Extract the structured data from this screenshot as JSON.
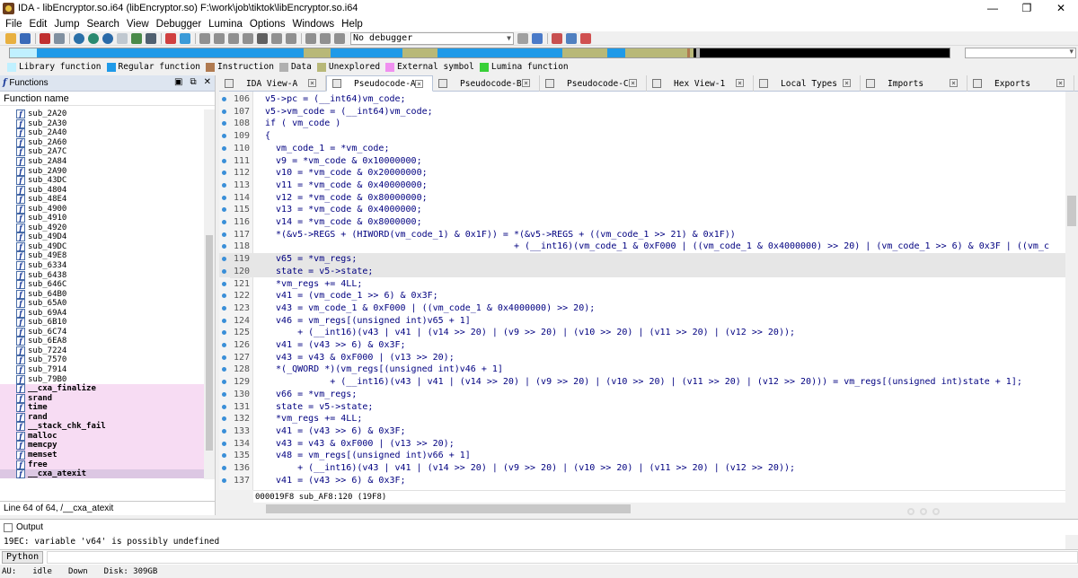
{
  "window": {
    "title": "IDA - libEncryptor.so.i64 (libEncryptor.so) F:\\work\\job\\tiktok\\libEncryptor.so.i64",
    "controls": [
      "—",
      "❐",
      "✕"
    ]
  },
  "menu": [
    "File",
    "Edit",
    "Jump",
    "Search",
    "View",
    "Debugger",
    "Lumina",
    "Options",
    "Windows",
    "Help"
  ],
  "toolbar": {
    "debugger_select": "No debugger"
  },
  "colors": {
    "library_function": "#c0f0ff",
    "regular_function": "#1f9ae8",
    "instruction": "#b07a50",
    "data": "#b0b0b0",
    "unexplored": "#b8b878",
    "external_symbol": "#f090f0",
    "lumina_function": "#38d038",
    "pane_header": "#dde5f0",
    "library_row": "#f7dcf3",
    "selected_row": "#dcc7e3"
  },
  "legend": [
    {
      "label": "Library function",
      "color": "#c0f0ff"
    },
    {
      "label": "Regular function",
      "color": "#1f9ae8"
    },
    {
      "label": "Instruction",
      "color": "#b07a50"
    },
    {
      "label": "Data",
      "color": "#b0b0b0"
    },
    {
      "label": "Unexplored",
      "color": "#b8b878"
    },
    {
      "label": "External symbol",
      "color": "#f090f0"
    },
    {
      "label": "Lumina function",
      "color": "#38d038"
    }
  ],
  "functions_pane": {
    "title": "Functions",
    "column": "Function name",
    "items": [
      {
        "name": "sub_2A20",
        "kind": "regular"
      },
      {
        "name": "sub_2A30",
        "kind": "regular"
      },
      {
        "name": "sub_2A40",
        "kind": "regular"
      },
      {
        "name": "sub_2A60",
        "kind": "regular"
      },
      {
        "name": "sub_2A7C",
        "kind": "regular"
      },
      {
        "name": "sub_2A84",
        "kind": "regular"
      },
      {
        "name": "sub_2A90",
        "kind": "regular"
      },
      {
        "name": "sub_43DC",
        "kind": "regular"
      },
      {
        "name": "sub_4804",
        "kind": "regular"
      },
      {
        "name": "sub_48E4",
        "kind": "regular"
      },
      {
        "name": "sub_4900",
        "kind": "regular"
      },
      {
        "name": "sub_4910",
        "kind": "regular"
      },
      {
        "name": "sub_4920",
        "kind": "regular"
      },
      {
        "name": "sub_49D4",
        "kind": "regular"
      },
      {
        "name": "sub_49DC",
        "kind": "regular"
      },
      {
        "name": "sub_49E8",
        "kind": "regular"
      },
      {
        "name": "sub_6334",
        "kind": "regular"
      },
      {
        "name": "sub_6438",
        "kind": "regular"
      },
      {
        "name": "sub_646C",
        "kind": "regular"
      },
      {
        "name": "sub_64B0",
        "kind": "regular"
      },
      {
        "name": "sub_65A0",
        "kind": "regular"
      },
      {
        "name": "sub_69A4",
        "kind": "regular"
      },
      {
        "name": "sub_6B10",
        "kind": "regular"
      },
      {
        "name": "sub_6C74",
        "kind": "regular"
      },
      {
        "name": "sub_6EA8",
        "kind": "regular"
      },
      {
        "name": "sub_7224",
        "kind": "regular"
      },
      {
        "name": "sub_7570",
        "kind": "regular"
      },
      {
        "name": "sub_7914",
        "kind": "regular"
      },
      {
        "name": "sub_79B0",
        "kind": "regular"
      },
      {
        "name": "__cxa_finalize",
        "kind": "lib"
      },
      {
        "name": "srand",
        "kind": "lib"
      },
      {
        "name": "time",
        "kind": "lib"
      },
      {
        "name": "rand",
        "kind": "lib"
      },
      {
        "name": "__stack_chk_fail",
        "kind": "lib"
      },
      {
        "name": "malloc",
        "kind": "lib"
      },
      {
        "name": "memcpy",
        "kind": "lib"
      },
      {
        "name": "memset",
        "kind": "lib"
      },
      {
        "name": "free",
        "kind": "lib"
      },
      {
        "name": "__cxa_atexit",
        "kind": "sel"
      }
    ],
    "status": "Line 64 of 64, /__cxa_atexit"
  },
  "tabs": [
    {
      "label": "IDA View-A",
      "active": false
    },
    {
      "label": "Pseudocode-A",
      "active": true
    },
    {
      "label": "Pseudocode-B",
      "active": false
    },
    {
      "label": "Pseudocode-C",
      "active": false
    },
    {
      "label": "Hex View-1",
      "active": false
    },
    {
      "label": "Local Types",
      "active": false
    },
    {
      "label": "Imports",
      "active": false
    },
    {
      "label": "Exports",
      "active": false
    }
  ],
  "code": {
    "lines": [
      {
        "n": "106",
        "text": "v5->pc = (__int64)vm_code;"
      },
      {
        "n": "107",
        "text": "v5->vm_code = (__int64)vm_code;"
      },
      {
        "n": "108",
        "text": "if ( vm_code )"
      },
      {
        "n": "109",
        "text": "{"
      },
      {
        "n": "110",
        "text": "  vm_code_1 = *vm_code;"
      },
      {
        "n": "111",
        "text": "  v9 = *vm_code & 0x10000000;"
      },
      {
        "n": "112",
        "text": "  v10 = *vm_code & 0x20000000;"
      },
      {
        "n": "113",
        "text": "  v11 = *vm_code & 0x40000000;"
      },
      {
        "n": "114",
        "text": "  v12 = *vm_code & 0x80000000;"
      },
      {
        "n": "115",
        "text": "  v13 = *vm_code & 0x4000000;"
      },
      {
        "n": "116",
        "text": "  v14 = *vm_code & 0x8000000;"
      },
      {
        "n": "117",
        "text": "  *(&v5->REGS + (HIWORD(vm_code_1) & 0x1F)) = *(&v5->REGS + ((vm_code_1 >> 21) & 0x1F))"
      },
      {
        "n": "118",
        "text": "                                              + (__int16)(vm_code_1 & 0xF000 | ((vm_code_1 & 0x4000000) >> 20) | (vm_code_1 >> 6) & 0x3F | ((vm_c"
      },
      {
        "n": "119",
        "text": "  v65 = *vm_regs;"
      },
      {
        "n": "120",
        "text": "  state = v5->state;"
      },
      {
        "n": "121",
        "text": "  *vm_regs += 4LL;"
      },
      {
        "n": "122",
        "text": "  v41 = (vm_code_1 >> 6) & 0x3F;"
      },
      {
        "n": "123",
        "text": "  v43 = vm_code_1 & 0xF000 | ((vm_code_1 & 0x4000000) >> 20);"
      },
      {
        "n": "124",
        "text": "  v46 = vm_regs[(unsigned int)v65 + 1]"
      },
      {
        "n": "125",
        "text": "      + (__int16)(v43 | v41 | (v14 >> 20) | (v9 >> 20) | (v10 >> 20) | (v11 >> 20) | (v12 >> 20));"
      },
      {
        "n": "126",
        "text": "  v41 = (v43 >> 6) & 0x3F;"
      },
      {
        "n": "127",
        "text": "  v43 = v43 & 0xF000 | (v13 >> 20);"
      },
      {
        "n": "128",
        "text": "  *(_QWORD *)(vm_regs[(unsigned int)v46 + 1]"
      },
      {
        "n": "129",
        "text": "            + (__int16)(v43 | v41 | (v14 >> 20) | (v9 >> 20) | (v10 >> 20) | (v11 >> 20) | (v12 >> 20))) = vm_regs[(unsigned int)state + 1];"
      },
      {
        "n": "130",
        "text": "  v66 = *vm_regs;"
      },
      {
        "n": "131",
        "text": "  state = v5->state;"
      },
      {
        "n": "132",
        "text": "  *vm_regs += 4LL;"
      },
      {
        "n": "133",
        "text": "  v41 = (v43 >> 6) & 0x3F;"
      },
      {
        "n": "134",
        "text": "  v43 = v43 & 0xF000 | (v13 >> 20);"
      },
      {
        "n": "135",
        "text": "  v48 = vm_regs[(unsigned int)v66 + 1]"
      },
      {
        "n": "136",
        "text": "      + (__int16)(v43 | v41 | (v14 >> 20) | (v9 >> 20) | (v10 >> 20) | (v11 >> 20) | (v12 >> 20));"
      },
      {
        "n": "137",
        "text": "  v41 = (v43 >> 6) & 0x3F;"
      }
    ],
    "status": "000019F8 sub_AF8:120 (19F8)"
  },
  "output": {
    "title": "Output",
    "message": "19EC: variable 'v64' is possibly undefined",
    "python_button": "Python"
  },
  "statusbar": {
    "au": "AU:",
    "state": "idle",
    "direction": "Down",
    "disk": "Disk: 309GB"
  }
}
